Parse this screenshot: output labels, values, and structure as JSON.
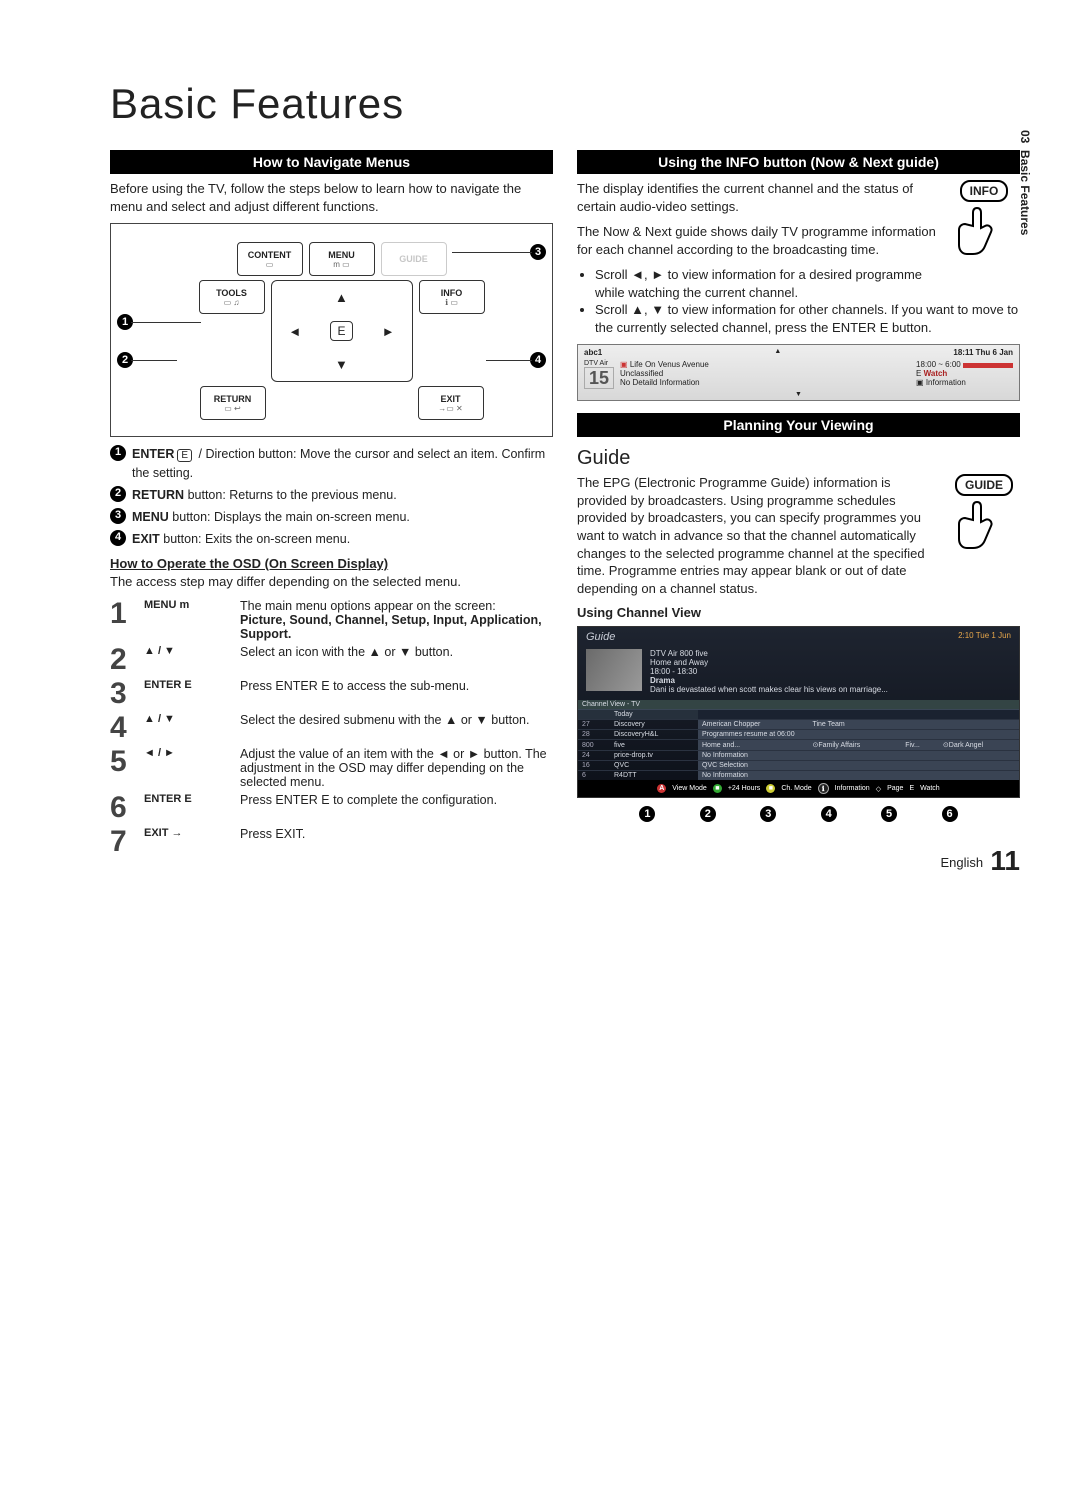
{
  "page_title": "Basic Features",
  "side_tab": {
    "chapter": "03",
    "label": "Basic Features"
  },
  "footer": {
    "lang": "English",
    "page": "11"
  },
  "left": {
    "section1": "How to Navigate Menus",
    "intro": "Before using the TV, follow the steps below to learn how to navigate the menu and select and adjust different functions.",
    "remote": {
      "top": {
        "content": "CONTENT",
        "menu": "MENU",
        "guide": "GUIDE"
      },
      "mid": {
        "tools": "TOOLS",
        "info": "INFO"
      },
      "bottom": {
        "ret": "RETURN",
        "exit": "EXIT"
      },
      "enter_symbol": "E"
    },
    "legend": [
      {
        "n": "1",
        "bold": "ENTER",
        "sym": "E",
        "text": " / Direction button: Move the cursor and select an item. Confirm the setting."
      },
      {
        "n": "2",
        "bold": "RETURN",
        "text": " button: Returns to the previous menu."
      },
      {
        "n": "3",
        "bold": "MENU",
        "text": " button: Displays the main on-screen menu."
      },
      {
        "n": "4",
        "bold": "EXIT",
        "text": " button: Exits the on-screen menu."
      }
    ],
    "osd_head": "How to Operate the OSD (On Screen Display)",
    "osd_note": "The access step may differ depending on the selected menu.",
    "osd_steps": [
      {
        "n": "1",
        "key": "MENU m",
        "desc": "The main menu options appear on the screen:",
        "extra": "Picture, Sound, Channel, Setup, Input, Application, Support."
      },
      {
        "n": "2",
        "key": "▲ / ▼",
        "desc": "Select an icon with the ▲ or ▼ button."
      },
      {
        "n": "3",
        "key": "ENTER E",
        "desc": "Press ENTER E to access the sub-menu."
      },
      {
        "n": "4",
        "key": "▲ / ▼",
        "desc": "Select the desired submenu with the ▲ or ▼ button."
      },
      {
        "n": "5",
        "key": "◄ / ►",
        "desc": "Adjust the value of an item with the ◄ or ► button. The adjustment in the OSD may differ depending on the selected menu."
      },
      {
        "n": "6",
        "key": "ENTER E",
        "desc": "Press ENTER E to complete the configuration."
      },
      {
        "n": "7",
        "key": "EXIT →",
        "desc": "Press EXIT."
      }
    ]
  },
  "right": {
    "section1": "Using the INFO button (Now & Next guide)",
    "info_icon_label": "INFO",
    "info_p1": "The display identifies the current channel and the status of certain audio-video settings.",
    "info_p2": "The Now & Next guide shows daily TV programme information for each channel according to the broadcasting time.",
    "info_bullets": [
      "Scroll ◄, ► to view information for a desired programme while watching the current channel.",
      "Scroll ▲, ▼ to view information for other channels. If you want to move to the currently selected channel, press the ENTER E button."
    ],
    "info_osd": {
      "chname": "abc1",
      "clock": "18:11 Thu 6 Jan",
      "src": "DTV Air",
      "chnum": "15",
      "prog": "Life On Venus Avenue",
      "rating": "Unclassified",
      "detail": "No Detaild Information",
      "time": "18:00 ~ 6:00",
      "w": "Watch",
      "i": "Information"
    },
    "section2": "Planning Your Viewing",
    "guide_h2": "Guide",
    "guide_icon_label": "GUIDE",
    "guide_p": "The EPG (Electronic Programme Guide) information is provided by broadcasters. Using programme schedules provided by broadcasters, you can specify programmes you want to watch in advance so that the channel automatically changes to the selected programme channel at the specified time. Programme entries may appear blank or out of date depending on a channel status.",
    "using_channel_view": "Using  Channel View",
    "guide_osd": {
      "title": "Guide",
      "date": "2:10 Tue 1 Jun",
      "prog_meta": {
        "src": "DTV Air 800 five",
        "name": "Home and Away",
        "time": "18:00 - 18:30",
        "genre": "Drama",
        "desc": "Dani is devastated when scott makes clear his views on marriage..."
      },
      "chview_label": "Channel View - TV",
      "today": "Today",
      "rows": [
        {
          "no": "27",
          "name": "Discovery",
          "cells": [
            "American Chopper",
            "Tine Team"
          ]
        },
        {
          "no": "28",
          "name": "DiscoveryH&L",
          "cells": [
            "Programmes resume at 06:00"
          ]
        },
        {
          "no": "800",
          "name": "five",
          "cells": [
            "Home and...",
            "⊙Family Affairs",
            "Fiv...",
            "⊙Dark Angel"
          ]
        },
        {
          "no": "24",
          "name": "price-drop.tv",
          "cells": [
            "No Information"
          ]
        },
        {
          "no": "16",
          "name": "QVC",
          "cells": [
            "QVC Selection"
          ]
        },
        {
          "no": "6",
          "name": "R4DTT",
          "cells": [
            "No Information"
          ]
        }
      ],
      "footer_items": [
        "View Mode",
        "+24 Hours",
        "Ch. Mode",
        "Information",
        "Page",
        "Watch"
      ]
    },
    "guide_callouts": [
      "1",
      "2",
      "3",
      "4",
      "5",
      "6"
    ]
  }
}
